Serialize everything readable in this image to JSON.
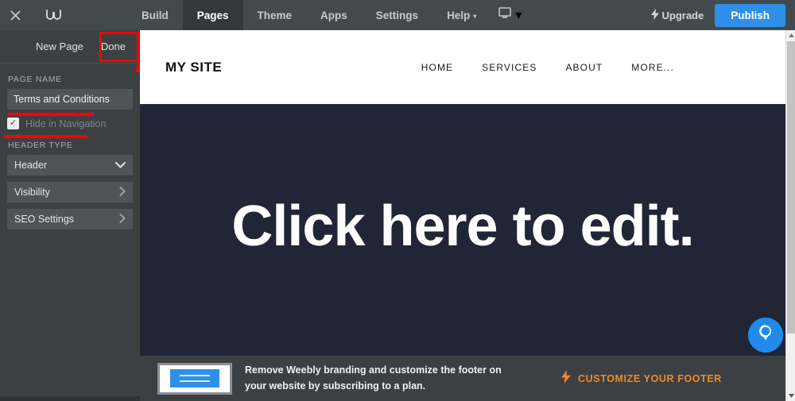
{
  "topbar": {
    "close_icon": "close-x-icon",
    "logo_icon": "weebly-w-logo",
    "tabs": [
      {
        "label": "Build",
        "active": false,
        "caret": ""
      },
      {
        "label": "Pages",
        "active": true,
        "caret": ""
      },
      {
        "label": "Theme",
        "active": false,
        "caret": ""
      },
      {
        "label": "Apps",
        "active": false,
        "caret": ""
      },
      {
        "label": "Settings",
        "active": false,
        "caret": ""
      },
      {
        "label": "Help",
        "active": false,
        "caret": "▾"
      }
    ],
    "device_icon": "monitor-icon",
    "device_caret": "▾",
    "upgrade_label": "Upgrade",
    "upgrade_icon": "lightning-bolt-icon",
    "publish_label": "Publish",
    "publish_color": "#2f8fe8"
  },
  "sidebar": {
    "new_page_label": "New Page",
    "done_label": "Done",
    "page_name_heading": "PAGE NAME",
    "page_name_value": "Terms and Conditions",
    "hide_in_navigation_label": "Hide in Navigation",
    "hide_in_navigation_checked": true,
    "checkmark": "✓",
    "header_type_heading": "HEADER TYPE",
    "header_type_value": "Header",
    "header_type_caret": "⌄",
    "rows": [
      {
        "label": "Visibility",
        "chevron": "›"
      },
      {
        "label": "SEO Settings",
        "chevron": "›"
      }
    ]
  },
  "annotations": {
    "highlight_color": "#ff0000",
    "done_box_target": "Done",
    "underline_targets": [
      "Terms and Conditions",
      "Hide in Navigation"
    ],
    "arrow_points_to": "Done"
  },
  "preview": {
    "site_title": "MY SITE",
    "site_nav": [
      "HOME",
      "SERVICES",
      "ABOUT",
      "MORE..."
    ],
    "edit_placeholder": "Click here to edit.",
    "background_color": "#212636",
    "header_background": "#ffffff"
  },
  "help_bubble": {
    "icon": "lightbulb-icon",
    "color": "#1f8ceb"
  },
  "footer_banner": {
    "thumbnail_icon": "website-thumbnail-image",
    "message": "Remove Weebly branding and customize the footer on your website by subscribing to a plan.",
    "cta_label": "CUSTOMIZE YOUR FOOTER",
    "cta_icon": "lightning-bolt-icon",
    "cta_color": "#f08a24"
  },
  "scrollbar": {
    "up_arrow": "▲",
    "down_arrow": "▼"
  }
}
